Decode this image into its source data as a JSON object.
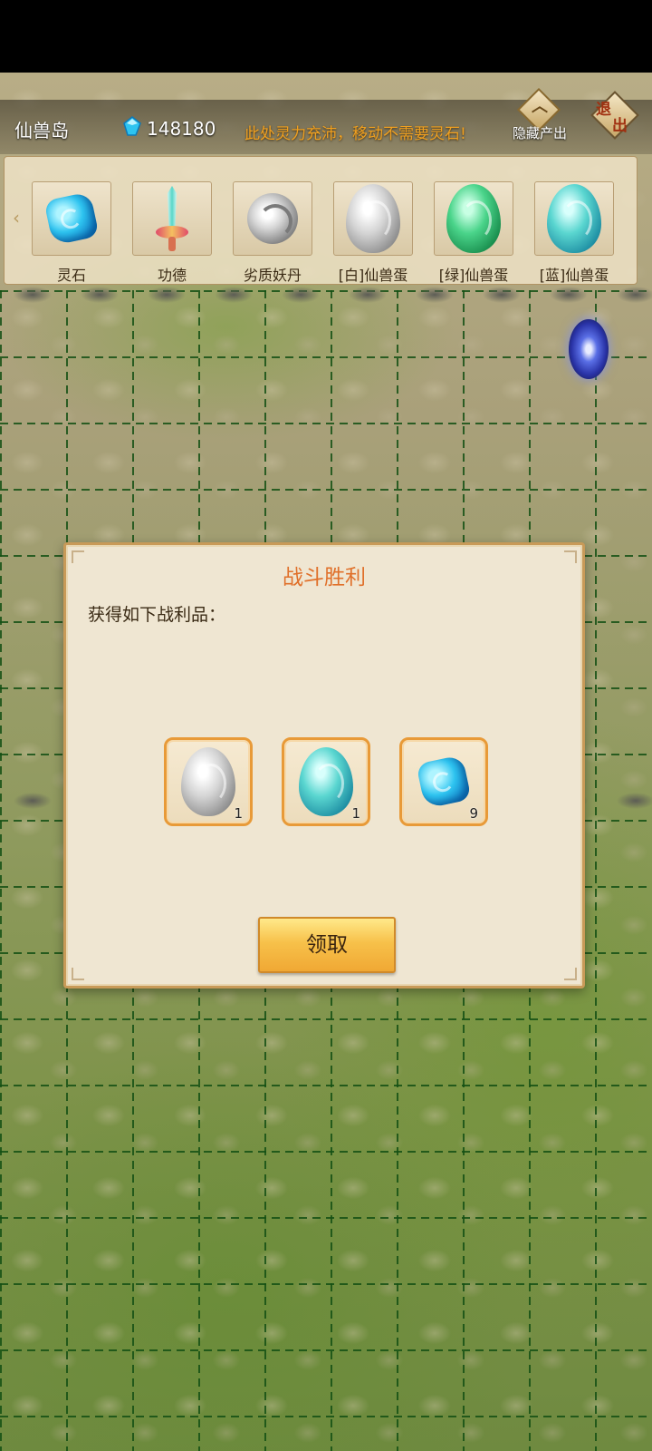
{
  "header": {
    "map_name": "仙兽岛",
    "currency_amount": "148180",
    "notice": "此处灵力充沛，移动不需要灵石!",
    "hide_button_label": "隐藏产出",
    "exit_label_1": "退",
    "exit_label_2": "出"
  },
  "strip": {
    "items": [
      {
        "label": "灵石",
        "icon": "spirit-stone-icon"
      },
      {
        "label": "功德",
        "icon": "merit-sword-icon"
      },
      {
        "label": "劣质妖丹",
        "icon": "demon-pill-icon"
      },
      {
        "label": "[白]仙兽蛋",
        "icon": "white-egg-icon"
      },
      {
        "label": "[绿]仙兽蛋",
        "icon": "green-egg-icon"
      },
      {
        "label": "[蓝]仙兽蛋",
        "icon": "blue-egg-icon"
      }
    ]
  },
  "dialog": {
    "title": "战斗胜利",
    "subtitle": "获得如下战利品：",
    "rewards": [
      {
        "icon": "white-egg-icon",
        "qty": "1"
      },
      {
        "icon": "blue-egg-icon",
        "qty": "1"
      },
      {
        "icon": "spirit-stone-icon",
        "qty": "9"
      }
    ],
    "claim_label": "领取"
  },
  "colors": {
    "accent_orange": "#e0702a",
    "notice_orange": "#f0a020",
    "dialog_bg": "#efe6d2",
    "button_gold": "#f7c14a"
  }
}
